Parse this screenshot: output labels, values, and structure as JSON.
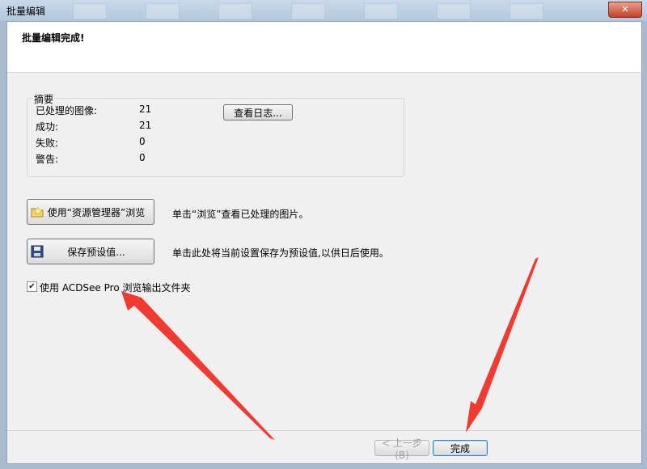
{
  "window": {
    "title": "批量编辑",
    "close": "✕"
  },
  "header": {
    "title": "批量编辑完成!"
  },
  "summary": {
    "legend": "摘要",
    "rows": [
      {
        "label": "已处理的图像:",
        "value": "21"
      },
      {
        "label": "成功:",
        "value": "21"
      },
      {
        "label": "失败:",
        "value": "0"
      },
      {
        "label": "警告:",
        "value": "0"
      }
    ],
    "view_log_label": "查看日志..."
  },
  "actions": {
    "browse_label": "使用“资源管理器”浏览",
    "browse_desc": "单击“浏览”查看已处理的图片。",
    "save_preset_label": "保存预设值...",
    "save_preset_desc": "单击此处将当前设置保存为预设值,以供日后使用。"
  },
  "option": {
    "label": "使用 ACDSee Pro 浏览输出文件夹",
    "checked": true
  },
  "footer": {
    "back_label": "< 上一步(B)",
    "finish_label": "完成"
  },
  "colors": {
    "arrow": "#f03a32",
    "accent": "#3c7fb1"
  },
  "icons": {
    "browse": "folder-icon",
    "save": "floppy-disk-icon",
    "check": "checkmark-icon"
  }
}
